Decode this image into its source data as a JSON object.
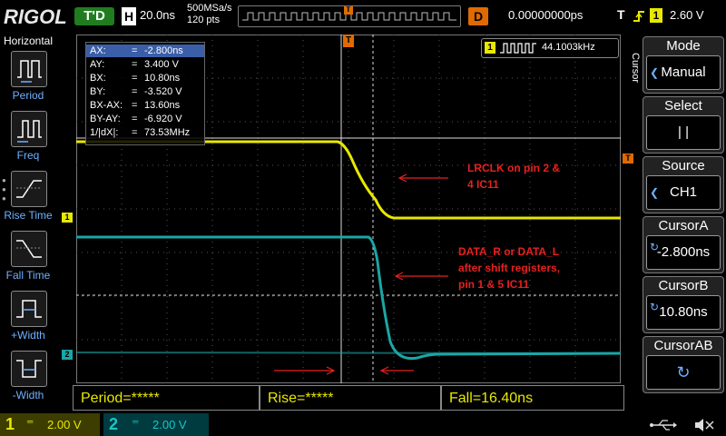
{
  "brand": "RIGOL",
  "top": {
    "run_state": "T'D",
    "h_label": "H",
    "timebase": "20.0ns",
    "sample_rate": "500MSa/s",
    "mem_depth": "120 pts",
    "trigger_marker": "T",
    "delay_label": "D",
    "delay_value": "0.00000000ps",
    "trig_label": "T",
    "trig_channel": "1",
    "trig_level": "2.60 V"
  },
  "left_panel": {
    "title": "Horizontal",
    "items": [
      {
        "label": "Period",
        "icon": "period-icon"
      },
      {
        "label": "Freq",
        "icon": "freq-icon"
      },
      {
        "label": "Rise Time",
        "icon": "rise-time-icon"
      },
      {
        "label": "Fall Time",
        "icon": "fall-time-icon"
      },
      {
        "label": "+Width",
        "icon": "pos-width-icon"
      },
      {
        "label": "-Width",
        "icon": "neg-width-icon"
      }
    ]
  },
  "cursor_readout": {
    "rows": [
      {
        "key": "AX:",
        "value": "-2.800ns"
      },
      {
        "key": "AY:",
        "value": "3.400 V"
      },
      {
        "key": "BX:",
        "value": "10.80ns"
      },
      {
        "key": "BY:",
        "value": "-3.520 V"
      },
      {
        "key": "BX-AX:",
        "value": "13.60ns"
      },
      {
        "key": "BY-AY:",
        "value": "-6.920 V"
      },
      {
        "key": "1/|dX|:",
        "value": "73.53MHz"
      }
    ],
    "eq": "="
  },
  "freq": {
    "channel": "1",
    "value": "44.1003kHz"
  },
  "annotations": {
    "lrclk_line1": "LRCLK on pin 2 &",
    "lrclk_line2": "4  IC11",
    "data_line1": "DATA_R or DATA_L",
    "data_line2": "after shift registers,",
    "data_line3": "pin 1 & 5 IC11"
  },
  "markers": {
    "ch1": "1",
    "ch2": "2",
    "cursor_t": "T"
  },
  "measurements": {
    "period": "Period=*****",
    "rise": "Rise=*****",
    "fall": "Fall=16.40ns"
  },
  "bottom": {
    "ch1_num": "1",
    "ch1_scale": "2.00 V",
    "ch2_num": "2",
    "ch2_scale": "2.00 V"
  },
  "right_panel": {
    "side_title": "Cursor",
    "mode_title": "Mode",
    "mode_value": "Manual",
    "select_title": "Select",
    "select_value": "| |",
    "source_title": "Source",
    "source_value": "CH1",
    "cursora_title": "CursorA",
    "cursora_value": "-2.800ns",
    "cursorb_title": "CursorB",
    "cursorb_value": "10.80ns",
    "cursorab_title": "CursorAB"
  },
  "colors": {
    "ch1": "#e8e800",
    "ch2": "#1aa6a6",
    "accent": "#e06a00",
    "annotation": "#e82020"
  }
}
